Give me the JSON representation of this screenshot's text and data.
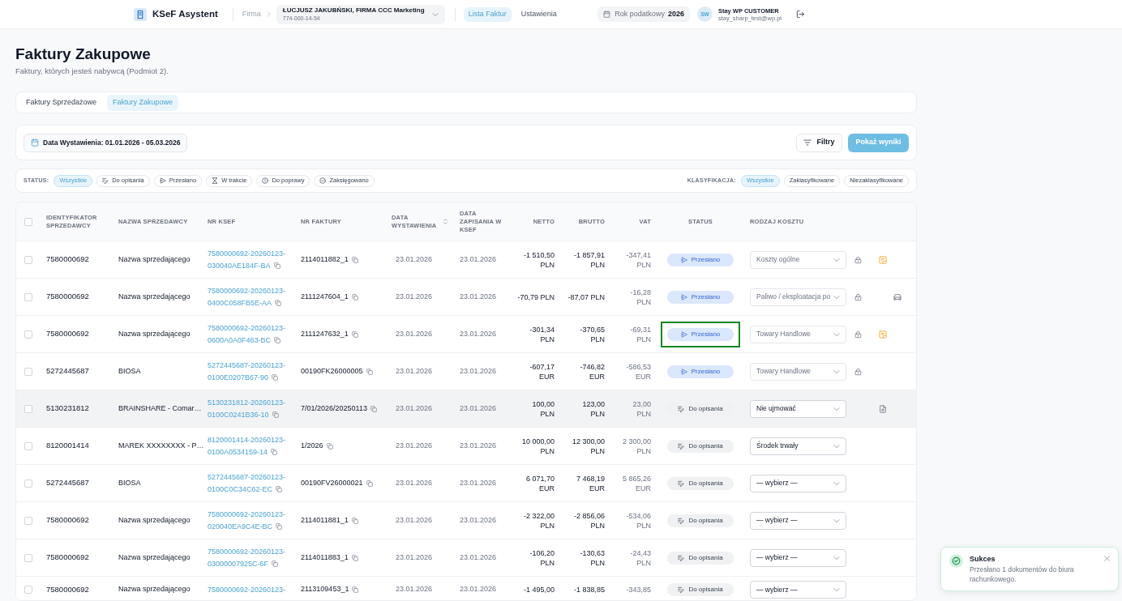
{
  "header": {
    "app_name": "KSeF Asystent",
    "company_label": "Firma",
    "company": {
      "name": "ŁUCJUSZ JAKUBŃSKI, FIRMA CCC Marketing",
      "nip": "774-000-14-54"
    },
    "nav": [
      {
        "label": "Lista Faktur",
        "selected": true
      },
      {
        "label": "Ustawienia",
        "selected": false
      }
    ],
    "tax_year": {
      "label": "Rok podatkowy",
      "value": "2026"
    },
    "user": {
      "initials": "SW",
      "name": "Stay WP CUSTOMER",
      "email": "stay_sharp_test@wp.pl"
    }
  },
  "page": {
    "title": "Faktury Zakupowe",
    "subtitle": "Faktury, których jesteś nabywcą (Podmiot 2)."
  },
  "tabs": [
    {
      "label": "Faktury Sprzedażowe",
      "selected": false
    },
    {
      "label": "Faktury Zakupowe",
      "selected": true
    }
  ],
  "filter_bar": {
    "date_range": "Data Wystawienia: 01.01.2026 - 05.03.2026",
    "filters_button": "Filtry",
    "show_results_button": "Pokaż wyniki"
  },
  "status_filter": {
    "label": "STATUS:",
    "options": [
      {
        "label": "Wszystkie",
        "kind": "all",
        "selected": true
      },
      {
        "label": "Do opisania",
        "kind": "to_describe",
        "selected": false
      },
      {
        "label": "Przesłano",
        "kind": "sent",
        "selected": false
      },
      {
        "label": "W trakcie",
        "kind": "in_progress",
        "selected": false
      },
      {
        "label": "Do poprawy",
        "kind": "to_fix",
        "selected": false
      },
      {
        "label": "Zaksięgowano",
        "kind": "booked",
        "selected": false
      }
    ]
  },
  "classification_filter": {
    "label": "KLASYFIKACJA:",
    "options": [
      {
        "label": "Wszystkie",
        "selected": true
      },
      {
        "label": "Zaklasyfikowane",
        "selected": false
      },
      {
        "label": "Niezaklasyfikowane",
        "selected": false
      }
    ]
  },
  "table": {
    "select_all_checked": false,
    "columns": [
      {
        "label": "IDENTYFIKATOR SPRZEDAWCY",
        "sortable": false
      },
      {
        "label": "NAZWA SPRZEDAWCY",
        "sortable": false
      },
      {
        "label": "NR KSEF",
        "sortable": false
      },
      {
        "label": "NR FAKTURY",
        "sortable": false
      },
      {
        "label": "DATA WYSTAWIENIA",
        "sortable": true
      },
      {
        "label": "DATA ZAPISANIA W KSEF",
        "sortable": false
      },
      {
        "label": "NETTO",
        "sortable": false
      },
      {
        "label": "BRUTTO",
        "sortable": false
      },
      {
        "label": "VAT",
        "sortable": false
      },
      {
        "label": "STATUS",
        "sortable": false
      },
      {
        "label": "RODZAJ KOSZTU",
        "sortable": false
      }
    ],
    "rows": [
      {
        "checked": false,
        "hovered": false,
        "seller_id": "7580000692",
        "seller_name": "Nazwa sprzedającego",
        "ksef_number": "7580000692-20260123-030040AE184F-BA",
        "ksef_copy": true,
        "invoice_number": "2114011882_1",
        "issue_date": "23.01.2026",
        "saved_date": "23.01.2026",
        "net": "-1 510,50 PLN",
        "gross": "-1 857,91 PLN",
        "vat": "-347,41 PLN",
        "status": {
          "label": "Przesłano",
          "kind": "sent"
        },
        "highlighted": false,
        "cost_type": "Koszty ogólne",
        "locked": true,
        "indicator": {
          "kind": "note"
        }
      },
      {
        "checked": false,
        "hovered": false,
        "seller_id": "7580000692",
        "seller_name": "Nazwa sprzedającego",
        "ksef_number": "7580000692-20260123-0400C058FB5E-AA",
        "ksef_copy": true,
        "invoice_number": "2111247604_1",
        "issue_date": "23.01.2026",
        "saved_date": "23.01.2026",
        "net": "-70,79 PLN",
        "gross": "-87,07 PLN",
        "vat": "-16,28 PLN",
        "status": {
          "label": "Przesłano",
          "kind": "sent"
        },
        "highlighted": false,
        "cost_type": "Paliwo / eksploatacja po",
        "locked": true,
        "indicator": {
          "kind": "car"
        }
      },
      {
        "checked": false,
        "hovered": false,
        "seller_id": "7580000692",
        "seller_name": "Nazwa sprzedającego",
        "ksef_number": "7580000692-20260123-0600A0A0F463-BC",
        "ksef_copy": true,
        "invoice_number": "2111247632_1",
        "issue_date": "23.01.2026",
        "saved_date": "23.01.2026",
        "net": "-301,34 PLN",
        "gross": "-370,65 PLN",
        "vat": "-69,31 PLN",
        "status": {
          "label": "Przesłano",
          "kind": "sent"
        },
        "highlighted": true,
        "cost_type": "Towary Handlowe",
        "locked": true,
        "indicator": {
          "kind": "note"
        }
      },
      {
        "checked": false,
        "hovered": false,
        "seller_id": "5272445687",
        "seller_name": "BIOSA",
        "ksef_number": "5272445687-20260123-0100E0207B67-90",
        "ksef_copy": true,
        "invoice_number": "00190FK26000005",
        "issue_date": "23.01.2026",
        "saved_date": "23.01.2026",
        "net": "-607,17 EUR",
        "gross": "-746,82 EUR",
        "vat": "-586,53 EUR",
        "status": {
          "label": "Przesłano",
          "kind": "sent"
        },
        "highlighted": false,
        "cost_type": "Towary Handlowe",
        "locked": true
      },
      {
        "checked": false,
        "hovered": true,
        "seller_id": "5130231812",
        "seller_name": "BRAINSHARE - Comar…",
        "ksef_number": "5130231812-20260123-0100C0241B36-10",
        "ksef_copy": true,
        "invoice_number": "7/01/2026/20250113",
        "issue_date": "23.01.2026",
        "saved_date": "23.01.2026",
        "net": "100,00 PLN",
        "gross": "123,00 PLN",
        "vat": "23,00 PLN",
        "status": {
          "label": "Do opisania",
          "kind": "to_describe"
        },
        "highlighted": false,
        "cost_type": "Nie ujmować",
        "locked": false,
        "indicator": {
          "kind": "document"
        }
      },
      {
        "checked": false,
        "hovered": false,
        "seller_id": "8120001414",
        "seller_name": "MAREK XXXXXXXX - P…",
        "ksef_number": "8120001414-20260123-0100A0534159-14",
        "ksef_copy": true,
        "invoice_number": "1/2026",
        "issue_date": "23.01.2026",
        "saved_date": "23.01.2026",
        "net": "10 000,00 PLN",
        "gross": "12 300,00 PLN",
        "vat": "2 300,00 PLN",
        "status": {
          "label": "Do opisania",
          "kind": "to_describe"
        },
        "highlighted": false,
        "cost_type": "Środek trwały",
        "locked": false
      },
      {
        "checked": false,
        "hovered": false,
        "seller_id": "5272445687",
        "seller_name": "BIOSA",
        "ksef_number": "5272445687-20260123-0100C0C34C62-EC",
        "ksef_copy": true,
        "invoice_number": "00190FV26000021",
        "issue_date": "23.01.2026",
        "saved_date": "23.01.2026",
        "net": "6 071,70 EUR",
        "gross": "7 468,19 EUR",
        "vat": "5 865,26 EUR",
        "status": {
          "label": "Do opisania",
          "kind": "to_describe"
        },
        "highlighted": false,
        "cost_type": "— wybierz —",
        "locked": false
      },
      {
        "checked": false,
        "hovered": false,
        "seller_id": "7580000692",
        "seller_name": "Nazwa sprzedającego",
        "ksef_number": "7580000692-20260123-020040EA9C4E-BC",
        "ksef_copy": true,
        "invoice_number": "2114011881_1",
        "issue_date": "23.01.2026",
        "saved_date": "23.01.2026",
        "net": "-2 322,00 PLN",
        "gross": "-2 856,06 PLN",
        "vat": "-534,06 PLN",
        "status": {
          "label": "Do opisania",
          "kind": "to_describe"
        },
        "highlighted": false,
        "cost_type": "— wybierz —",
        "locked": false
      },
      {
        "checked": false,
        "hovered": false,
        "seller_id": "7580000692",
        "seller_name": "Nazwa sprzedającego",
        "ksef_number": "7580000692-20260123-03000007925C-6F",
        "ksef_copy": true,
        "invoice_number": "2114011883_1",
        "issue_date": "23.01.2026",
        "saved_date": "23.01.2026",
        "net": "-106,20 PLN",
        "gross": "-130,63 PLN",
        "vat": "-24,43 PLN",
        "status": {
          "label": "Do opisania",
          "kind": "to_describe"
        },
        "highlighted": false,
        "cost_type": "— wybierz —",
        "locked": false
      },
      {
        "checked": false,
        "hovered": false,
        "seller_id": "7580000692",
        "seller_name": "Nazwa sprzedającego",
        "ksef_number": "7580000692-20260123-",
        "ksef_copy": false,
        "invoice_number": "2113109453_1",
        "issue_date": "23.01.2026",
        "saved_date": "23.01.2026",
        "net": "-1 495,00",
        "gross": "-1 838,85",
        "vat": "-343,85",
        "status": {
          "label": "Do opisania",
          "kind": "to_describe"
        },
        "highlighted": false,
        "cost_type": "— wybierz —",
        "locked": false
      }
    ]
  },
  "toast": {
    "title": "Sukces",
    "message": "Przesłano 1 dokumentów do biura rachunkowego."
  }
}
